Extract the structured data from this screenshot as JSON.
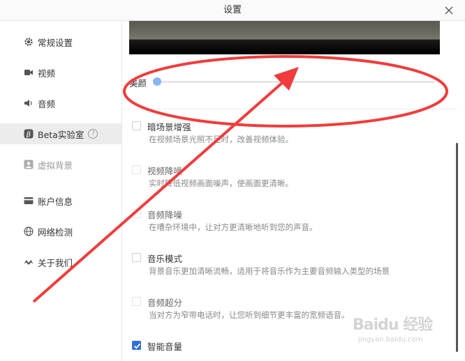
{
  "window": {
    "title": "设置"
  },
  "sidebar": {
    "items": [
      {
        "label": "常规设置"
      },
      {
        "label": "视频"
      },
      {
        "label": "音频"
      },
      {
        "label": "Beta实验室"
      },
      {
        "label": "虚拟背景"
      },
      {
        "label": "账户信息"
      },
      {
        "label": "网络检测"
      },
      {
        "label": "关于我们"
      }
    ]
  },
  "beauty": {
    "label": "美颜",
    "value": 0
  },
  "options": [
    {
      "label": "暗场景增强",
      "desc": "在视频场景光照不足时，改善视频体验。",
      "checked": false
    },
    {
      "label": "视频降噪",
      "desc": "实时降低视频画面噪声，使画面更清晰。",
      "checked": false
    },
    {
      "label": "音频降噪",
      "desc": "在嘈杂环境中，让对方更清晰地听到您的声音。",
      "checked": false
    },
    {
      "label": "音乐模式",
      "desc": "背景音乐更加清晰流畅，适用于将音乐作为主要音频输入类型的场景",
      "checked": false
    },
    {
      "label": "音频超分",
      "desc": "当对方为窄带电话时，让您听到细节更丰富的宽频语音。",
      "checked": false
    },
    {
      "label": "智能音量",
      "desc": "",
      "checked": true
    }
  ],
  "watermark": {
    "brand": "Baidu 经验",
    "url": "jingyan.baidu.com"
  },
  "colors": {
    "accent": "#2f6fd6",
    "annotation": "#f03c3c",
    "slider_thumb": "#8ab4f8"
  }
}
